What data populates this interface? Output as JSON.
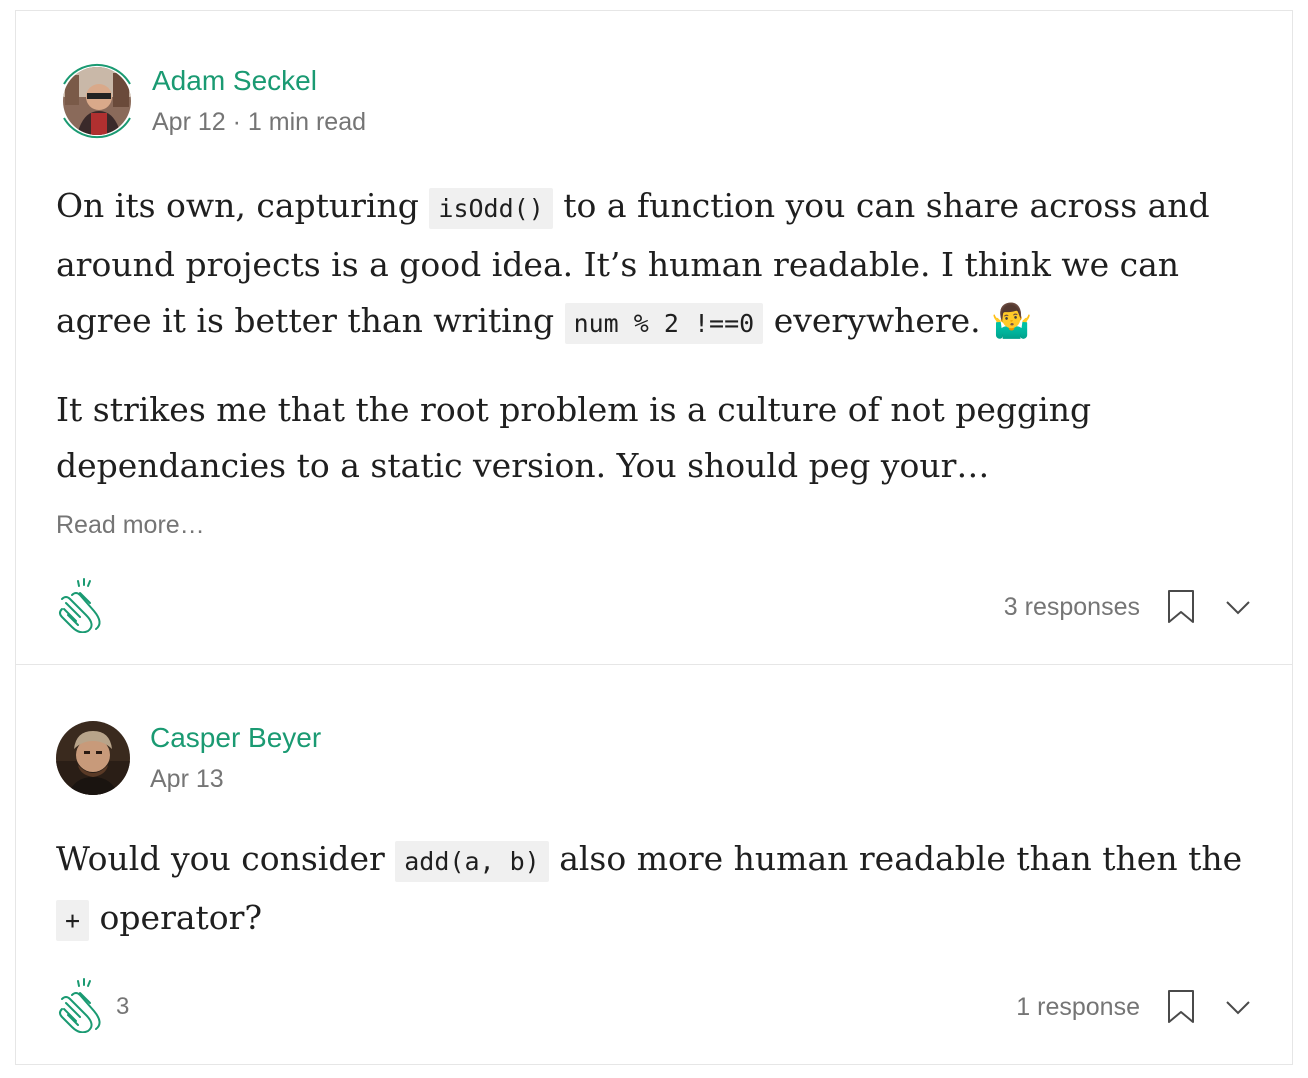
{
  "responses": [
    {
      "author": "Adam Seckel",
      "date": "Apr 12",
      "read_time": "1 min read",
      "meta_separator": " · ",
      "p1_a": "On its own, capturing ",
      "p1_code1": "isOdd()",
      "p1_b": " to a function you can share across and around projects is a good idea. It’s human readable. I think we can agree it is better than writing ",
      "p1_code2": "num % 2 !==0",
      "p1_c": " everywhere. 🤷‍♂",
      "p2": "It strikes me that the root problem is a culture of not pegging dependancies to a static version. You should peg your…",
      "read_more": "Read more…",
      "clap_count": "",
      "responses_label": "3 responses"
    },
    {
      "author": "Casper Beyer",
      "date": "Apr 13",
      "p1_a": "Would you consider ",
      "p1_code1": "add(a, b)",
      "p1_b": " also more human readable than then the ",
      "p1_code2": "+",
      "p1_c": " operator?",
      "clap_count": "3",
      "responses_label": "1 response"
    }
  ],
  "colors": {
    "accent": "#1a9a72",
    "muted": "#757575",
    "text": "#1f1f1f",
    "code_bg": "#f0f0f0",
    "border": "#e6e6e6"
  },
  "icons": [
    "clap-icon",
    "bookmark-icon",
    "chevron-down-icon"
  ]
}
